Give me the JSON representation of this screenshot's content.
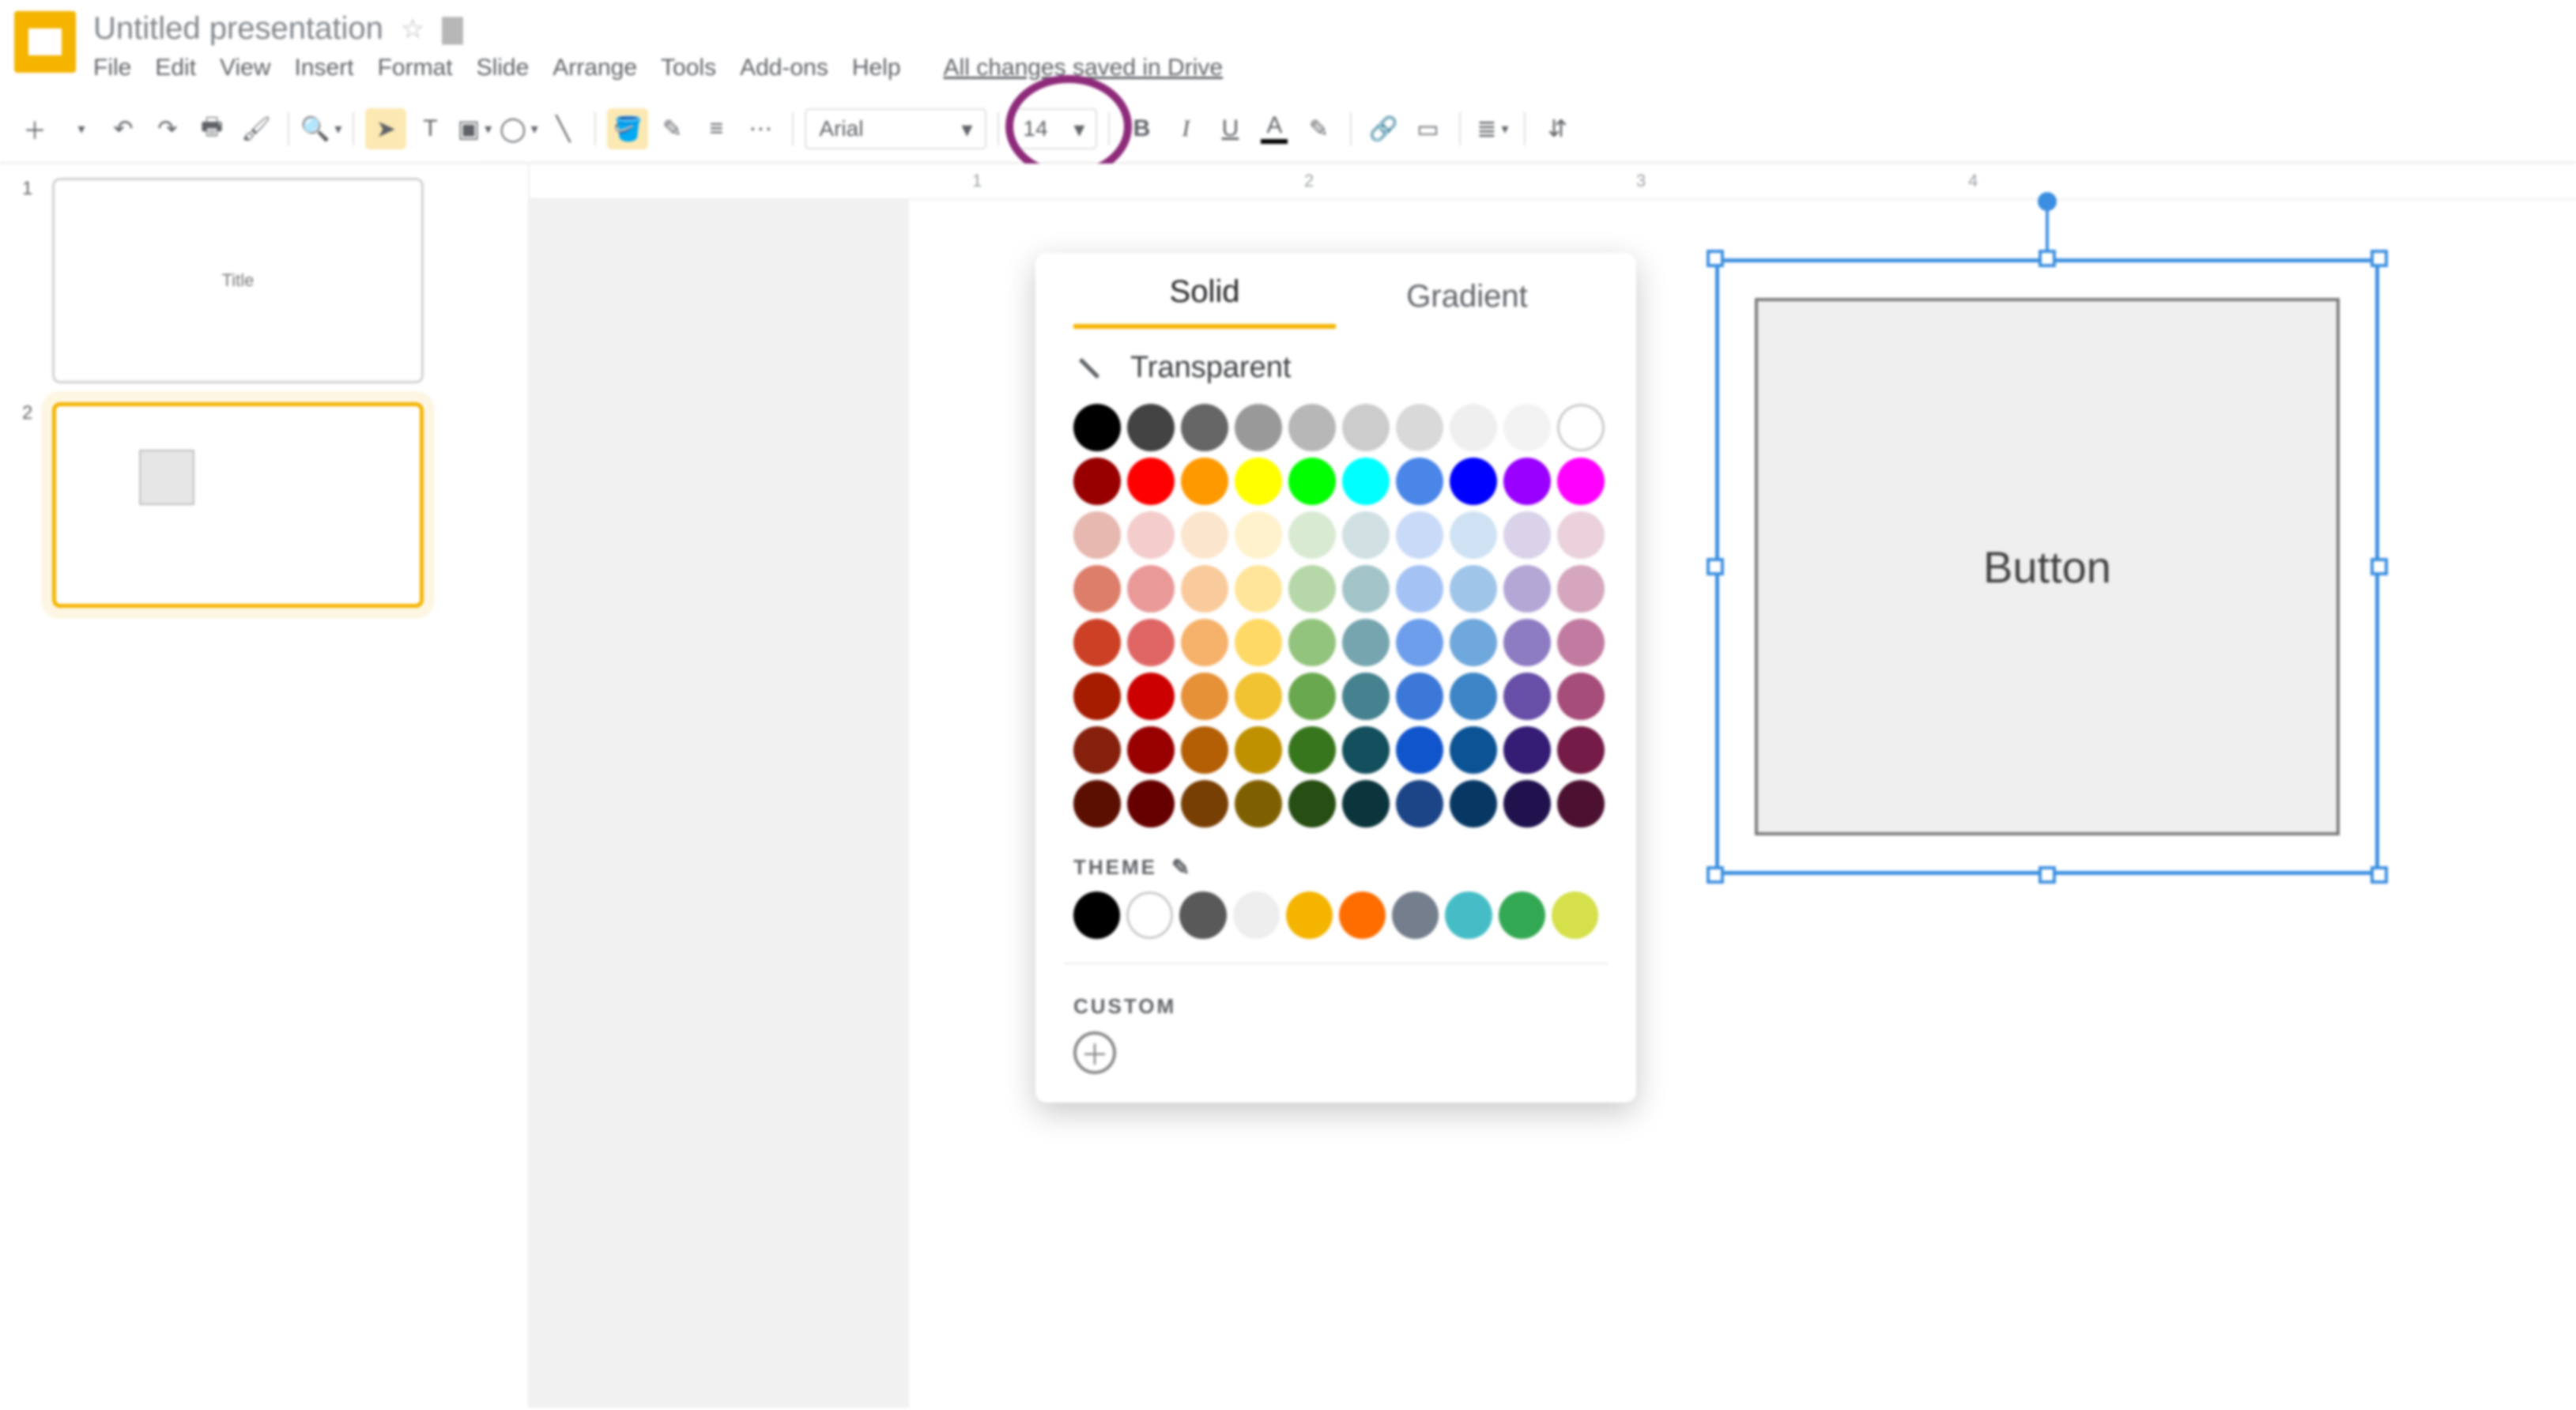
{
  "header": {
    "doc_title": "Untitled presentation",
    "menus": [
      "File",
      "Edit",
      "View",
      "Insert",
      "Format",
      "Slide",
      "Arrange",
      "Tools",
      "Add-ons",
      "Help"
    ],
    "drive_status": "All changes saved in Drive"
  },
  "toolbar": {
    "font": "Arial",
    "font_size": "14"
  },
  "ruler": {
    "marks": [
      "1",
      "2",
      "3",
      "4"
    ]
  },
  "thumbnails": [
    {
      "number": "1",
      "label": "Title",
      "selected": false
    },
    {
      "number": "2",
      "label": "",
      "selected": true
    }
  ],
  "canvas": {
    "shape_text": "Button"
  },
  "fill_popup": {
    "tabs": {
      "solid": "Solid",
      "gradient": "Gradient",
      "active": "solid"
    },
    "transparent_label": "Transparent",
    "theme_label": "THEME",
    "custom_label": "CUSTOM",
    "swatches": [
      [
        "#000000",
        "#434343",
        "#666666",
        "#999999",
        "#b7b7b7",
        "#cccccc",
        "#d9d9d9",
        "#efefef",
        "#f3f3f3",
        "#ffffff"
      ],
      [
        "#980000",
        "#ff0000",
        "#ff9900",
        "#ffff00",
        "#00ff00",
        "#00ffff",
        "#4a86e8",
        "#0000ff",
        "#9900ff",
        "#ff00ff"
      ],
      [
        "#e6b8af",
        "#f4cccc",
        "#fce5cd",
        "#fff2cc",
        "#d9ead3",
        "#d0e0e3",
        "#c9daf8",
        "#cfe2f3",
        "#d9d2e9",
        "#ead1dc"
      ],
      [
        "#dd7e6b",
        "#ea9999",
        "#f9cb9c",
        "#ffe599",
        "#b6d7a8",
        "#a2c4c9",
        "#a4c2f4",
        "#9fc5e8",
        "#b4a7d6",
        "#d5a6bd"
      ],
      [
        "#cc4125",
        "#e06666",
        "#f6b26b",
        "#ffd966",
        "#93c47d",
        "#76a5af",
        "#6d9eeb",
        "#6fa8dc",
        "#8e7cc3",
        "#c27ba0"
      ],
      [
        "#a61c00",
        "#cc0000",
        "#e69138",
        "#f1c232",
        "#6aa84f",
        "#45818e",
        "#3c78d8",
        "#3d85c6",
        "#674ea7",
        "#a64d79"
      ],
      [
        "#85200c",
        "#990000",
        "#b45f06",
        "#bf9000",
        "#38761d",
        "#134f5c",
        "#1155cc",
        "#0b5394",
        "#351c75",
        "#741b47"
      ],
      [
        "#5b0f00",
        "#660000",
        "#783f04",
        "#7f6000",
        "#274e13",
        "#0c343d",
        "#1c4587",
        "#073763",
        "#20124d",
        "#4c1130"
      ]
    ],
    "theme_swatches": [
      "#000000",
      "#ffffff",
      "#595959",
      "#eeeeee",
      "#f4b400",
      "#ff6d01",
      "#747e8c",
      "#46bdc6",
      "#33a853",
      "#d5e04b"
    ]
  }
}
